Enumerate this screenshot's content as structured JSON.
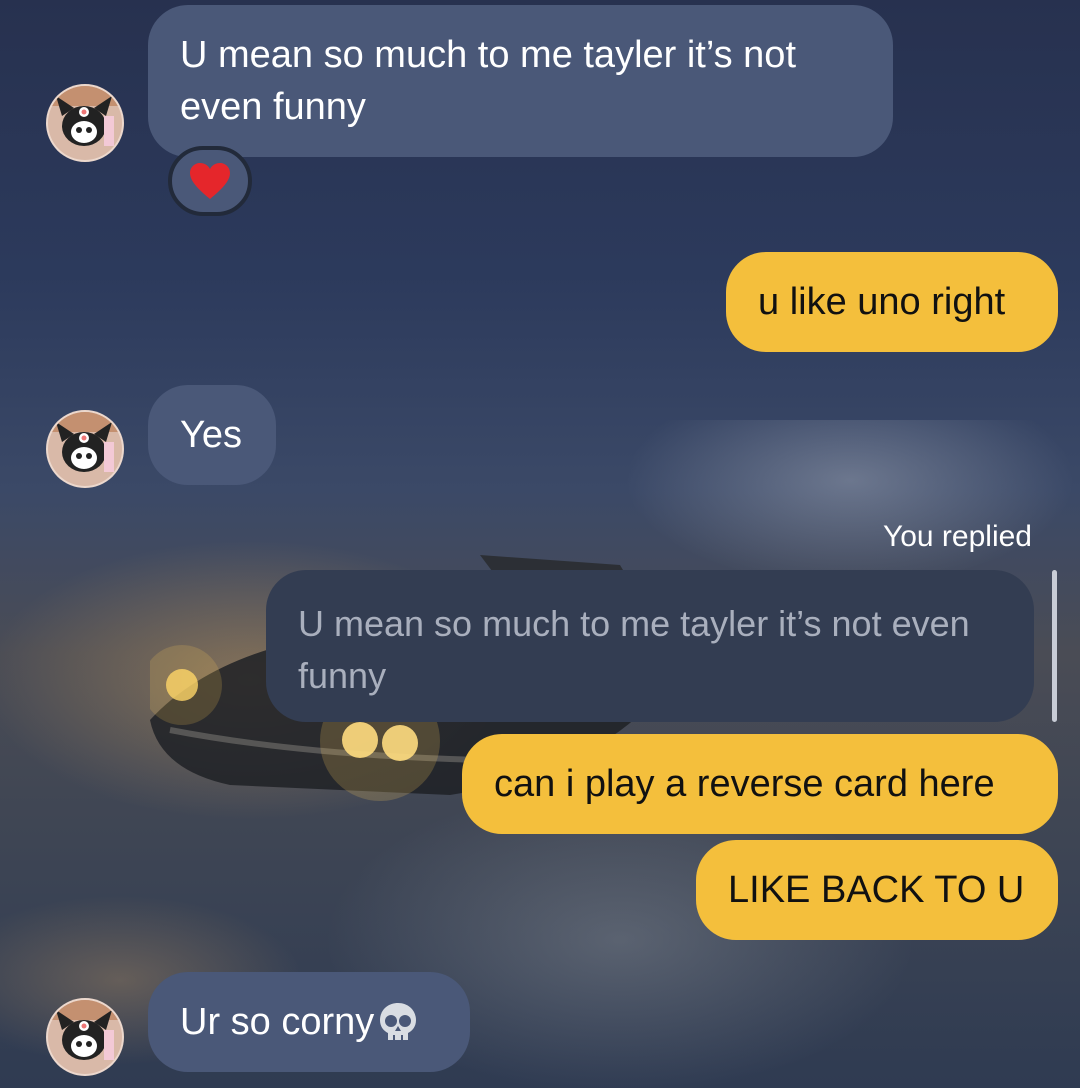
{
  "messages": {
    "m1": {
      "text": "U mean so much to me tayler it’s not even funny",
      "reaction": "❤️"
    },
    "m2": {
      "text": "u like uno right"
    },
    "m3": {
      "text": "Yes"
    },
    "reply": {
      "label": "You replied",
      "quoted": "U mean so much to me tayler it’s not even funny"
    },
    "m4": {
      "text": "can i play a reverse card here"
    },
    "m5": {
      "text": "LIKE BACK TO U"
    },
    "m6": {
      "text": "Ur so corny"
    }
  },
  "colors": {
    "incoming_bubble": "#4a5878",
    "outgoing_bubble": "#f4bf3c",
    "quoted_bubble": "#333d52"
  }
}
